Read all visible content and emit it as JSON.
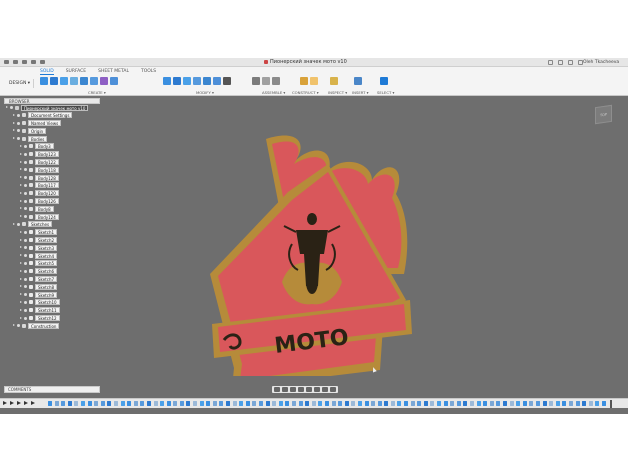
{
  "app": {
    "document_title": "Пионерский значек мото v10",
    "user": "Oleh Tkacheeva"
  },
  "toolbar": {
    "tabs": [
      "SOLID",
      "SURFACE",
      "SHEET METAL",
      "TOOLS"
    ],
    "active_tab": "SOLID",
    "design_label": "DESIGN ▾",
    "groups": [
      "CREATE ▾",
      "MODIFY ▾",
      "ASSEMBLE ▾",
      "CONSTRUCT ▾",
      "INSPECT ▾",
      "INSERT ▾",
      "SELECT ▾"
    ]
  },
  "browser": {
    "title": "BROWSER",
    "root": "Пионерский значек мото v10",
    "items": [
      "Document Settings",
      "Named Views",
      "Origin",
      "Bodies",
      "Body3",
      "Body123",
      "Body122",
      "Body118",
      "Body128",
      "Body117",
      "Body120",
      "Body126",
      "Body8",
      "Body124",
      "Sketches",
      "Sketch1",
      "Sketch2",
      "Sketch3",
      "Sketch4",
      "Sketch5",
      "Sketch6",
      "Sketch7",
      "Sketch8",
      "Sketch9",
      "Sketch10",
      "Sketch11",
      "Sketch12",
      "Construction"
    ]
  },
  "comments": {
    "title": "COMMENTS"
  },
  "viewcube": {
    "label": "TOP"
  },
  "model": {
    "text": "МОТО"
  },
  "colors": {
    "viewport_bg": "#6e6e6e",
    "emblem_red": "#d9575b",
    "emblem_gold": "#b68b3a",
    "accent_blue": "#1e7ad6"
  }
}
